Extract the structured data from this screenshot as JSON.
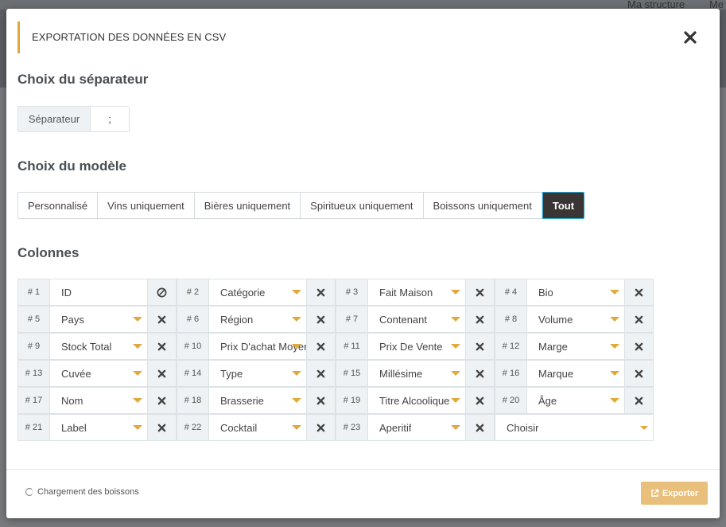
{
  "background": {
    "nav_links": [
      "Ma structure",
      "Me"
    ]
  },
  "modal": {
    "title": "EXPORTATION DES DONNÉES EN CSV",
    "separator_section": "Choix du séparateur",
    "separator_label": "Séparateur",
    "separator_value": ";",
    "model_section": "Choix du modèle",
    "models": [
      {
        "label": "Personnalisé",
        "active": false
      },
      {
        "label": "Vins uniquement",
        "active": false
      },
      {
        "label": "Bières uniquement",
        "active": false
      },
      {
        "label": "Spiritueux uniquement",
        "active": false
      },
      {
        "label": "Boissons uniquement",
        "active": false
      },
      {
        "label": "Tout",
        "active": true
      }
    ],
    "columns_section": "Colonnes",
    "columns": [
      {
        "num": "# 1",
        "label": "ID"
      },
      {
        "num": "# 2",
        "label": "Catégorie"
      },
      {
        "num": "# 3",
        "label": "Fait Maison"
      },
      {
        "num": "# 4",
        "label": "Bio"
      },
      {
        "num": "# 5",
        "label": "Pays"
      },
      {
        "num": "# 6",
        "label": "Région"
      },
      {
        "num": "# 7",
        "label": "Contenant"
      },
      {
        "num": "# 8",
        "label": "Volume"
      },
      {
        "num": "# 9",
        "label": "Stock Total"
      },
      {
        "num": "# 10",
        "label": "Prix D'achat Moyen"
      },
      {
        "num": "# 11",
        "label": "Prix De Vente"
      },
      {
        "num": "# 12",
        "label": "Marge"
      },
      {
        "num": "# 13",
        "label": "Cuvée"
      },
      {
        "num": "# 14",
        "label": "Type"
      },
      {
        "num": "# 15",
        "label": "Millésime"
      },
      {
        "num": "# 16",
        "label": "Marque"
      },
      {
        "num": "# 17",
        "label": "Nom"
      },
      {
        "num": "# 18",
        "label": "Brasserie"
      },
      {
        "num": "# 19",
        "label": "Titre Alcoolique"
      },
      {
        "num": "# 20",
        "label": "Âge"
      },
      {
        "num": "# 21",
        "label": "Label"
      },
      {
        "num": "# 22",
        "label": "Cocktail"
      },
      {
        "num": "# 23",
        "label": "Aperitif"
      }
    ],
    "choose_placeholder": "Choisir",
    "loading_text": "Chargement des boissons",
    "export_label": "Exporter",
    "colors": {
      "accent": "#e0a93a",
      "export_bg": "#e9c07b",
      "active_model_bg": "#3a3535",
      "active_model_border": "#2aa7d0"
    }
  }
}
